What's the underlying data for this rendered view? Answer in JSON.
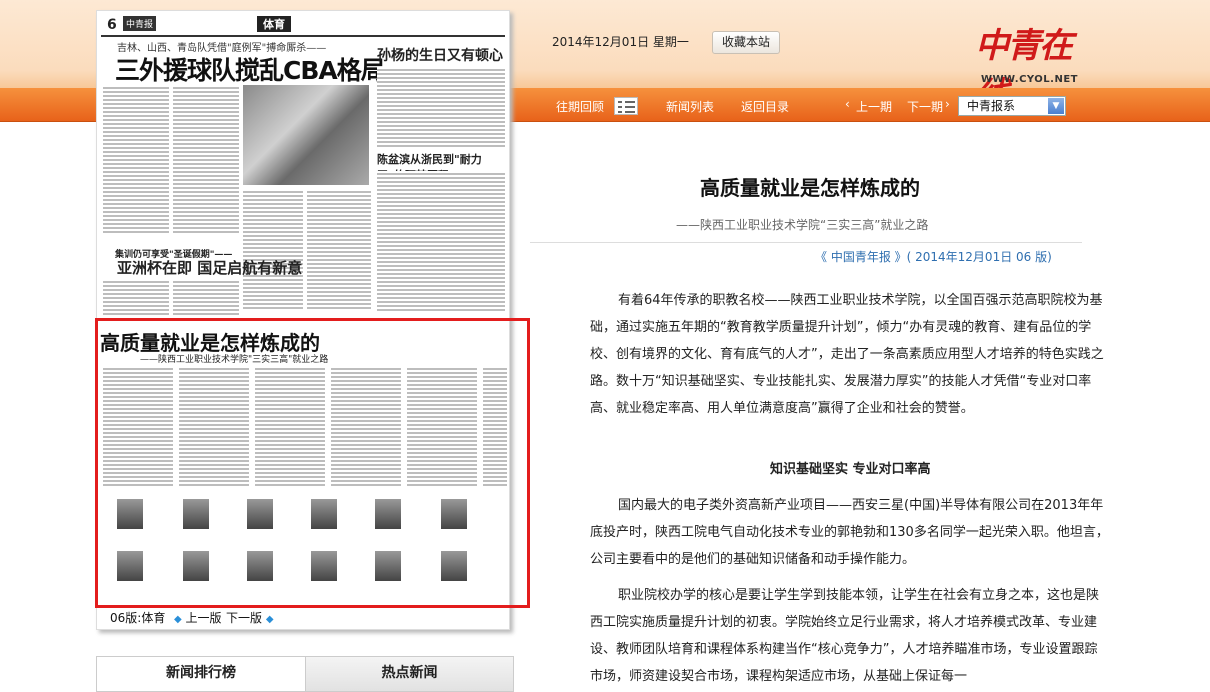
{
  "header": {
    "date": "2014年12月01日  星期一",
    "favorite_label": "收藏本站",
    "logo_cn": "中青在线",
    "logo_en": "WWW.CYOL.NET"
  },
  "nav": {
    "past_label": "往期回顾",
    "news_list_label": "新闻列表",
    "back_label": "返回目录",
    "prev_issue_label": "上一期",
    "next_issue_label": "下一期",
    "paper_select": "中青报系"
  },
  "newspaper": {
    "page_number": "6",
    "section": "体育",
    "headline_small": "吉林、山西、青岛队凭借\"庭例军\"搏命厮杀——",
    "headline_big": "三外援球队搅乱CBA格局",
    "headline_right": "孙杨的生日又有顿心事",
    "headline_right2": "陈盆滨从浙民到\"耐力王\"的阿梦历程",
    "headline_mid_small": "集训仍可享受\"圣诞假期\"——",
    "headline_mid": "亚洲杯在即  国足启航有新意",
    "inner_title": "高质量就业是怎样炼成的",
    "inner_subtitle": "——陕西工业职业技术学院\"三实三高\"就业之路"
  },
  "page_nav": {
    "page_label": "06版:体育",
    "prev_label": "上一版",
    "next_label": "下一版"
  },
  "tabs": [
    "新闻排行榜",
    "热点新闻"
  ],
  "article": {
    "title": "高质量就业是怎样炼成的",
    "subtitle": "——陕西工业职业技术学院“三实三高”就业之路",
    "source": "《 中国青年报 》( 2014年12月01日    06  版)",
    "paragraph1": "有着64年传承的职教名校——陕西工业职业技术学院，以全国百强示范高职院校为基础，通过实施五年期的“教育教学质量提升计划”，倾力“办有灵魂的教育、建有品位的学校、创有境界的文化、育有底气的人才”，走出了一条高素质应用型人才培养的特色实践之路。数十万“知识基础坚实、专业技能扎实、发展潜力厚实”的技能人才凭借“专业对口率高、就业稳定率高、用人单位满意度高”赢得了企业和社会的赞誉。",
    "section_heading": "知识基础坚实  专业对口率高",
    "paragraph2": "国内最大的电子类外资高新产业项目——西安三星(中国)半导体有限公司在2013年年底投产时，陕西工院电气自动化技术专业的郭艳勃和130多名同学一起光荣入职。他坦言，公司主要看中的是他们的基础知识储备和动手操作能力。",
    "paragraph3": "职业院校办学的核心是要让学生学到技能本领，让学生在社会有立身之本，这也是陕西工院实施质量提升计划的初衷。学院始终立足行业需求，将人才培养模式改革、专业建设、教师团队培育和课程体系构建当作“核心竞争力”，人才培养瞄准市场，专业设置跟踪市场，师资建设契合市场，课程构架适应市场，从基础上保证每一"
  },
  "colors": {
    "nav_orange": "#e8621a",
    "highlight_red": "#e31d1d",
    "link_blue": "#2f6fb0"
  }
}
